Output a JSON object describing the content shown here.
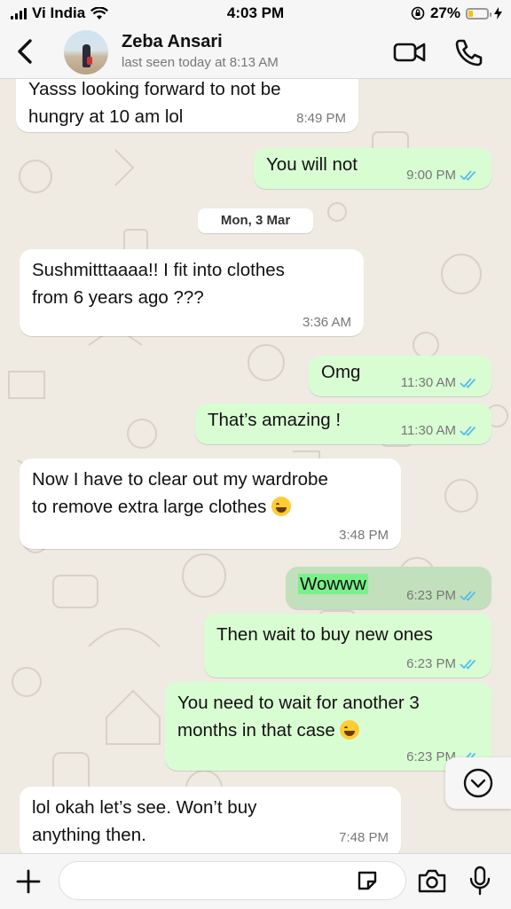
{
  "status_bar": {
    "carrier": "Vi India",
    "time": "4:03 PM",
    "battery_percent": "27%",
    "battery_level": 0.27,
    "battery_color": "#f5c400"
  },
  "header": {
    "contact_name": "Zeba Ansari",
    "last_seen": "last seen today at 8:13 AM",
    "icons": [
      "back-chevron-icon",
      "video-call-icon",
      "voice-call-icon"
    ]
  },
  "chat": {
    "date_separator": "Mon, 3 Mar",
    "messages": [
      {
        "direction": "in",
        "lines": [
          "Yasss looking forward to not be",
          "hungry at 10 am lol"
        ],
        "time": "8:49 PM"
      },
      {
        "direction": "out",
        "lines": [
          "You will not"
        ],
        "time": "9:00 PM",
        "status": "read"
      },
      {
        "direction": "in",
        "lines": [
          "Sushmitttaaaa!! I fit into clothes",
          "from 6 years ago ???"
        ],
        "time": "3:36 AM"
      },
      {
        "direction": "out",
        "lines": [
          "Omg"
        ],
        "time": "11:30 AM",
        "status": "read"
      },
      {
        "direction": "out",
        "lines": [
          "That’s amazing !"
        ],
        "time": "11:30 AM",
        "status": "read"
      },
      {
        "direction": "in",
        "lines": [
          "Now I have to clear out my wardrobe",
          "to remove extra large clothes"
        ],
        "time": "3:48 PM",
        "emoji": "rolling-on-floor-laughing-emoji"
      },
      {
        "direction": "out",
        "lines": [
          "Wowww"
        ],
        "time": "6:23 PM",
        "status": "read",
        "highlighted": true
      },
      {
        "direction": "out",
        "lines": [
          "Then wait to buy new ones"
        ],
        "time": "6:23 PM",
        "status": "read"
      },
      {
        "direction": "out",
        "lines": [
          "You need to wait for another 3",
          "months in that case"
        ],
        "time": "6:23 PM",
        "status": "read",
        "emoji": "tears-of-joy-emoji"
      },
      {
        "direction": "in",
        "lines": [
          "lol okah let’s see. Won’t buy",
          "anything then."
        ],
        "time": "7:48 PM"
      }
    ],
    "colors": {
      "incoming": "#ffffff",
      "outgoing": "#d9fdd3",
      "read_ticks": "#53bdeb",
      "highlight": "#7bf08a"
    }
  },
  "composer": {
    "placeholder": "",
    "icons": [
      "plus-icon",
      "sticker-icon",
      "camera-icon",
      "microphone-icon"
    ]
  }
}
